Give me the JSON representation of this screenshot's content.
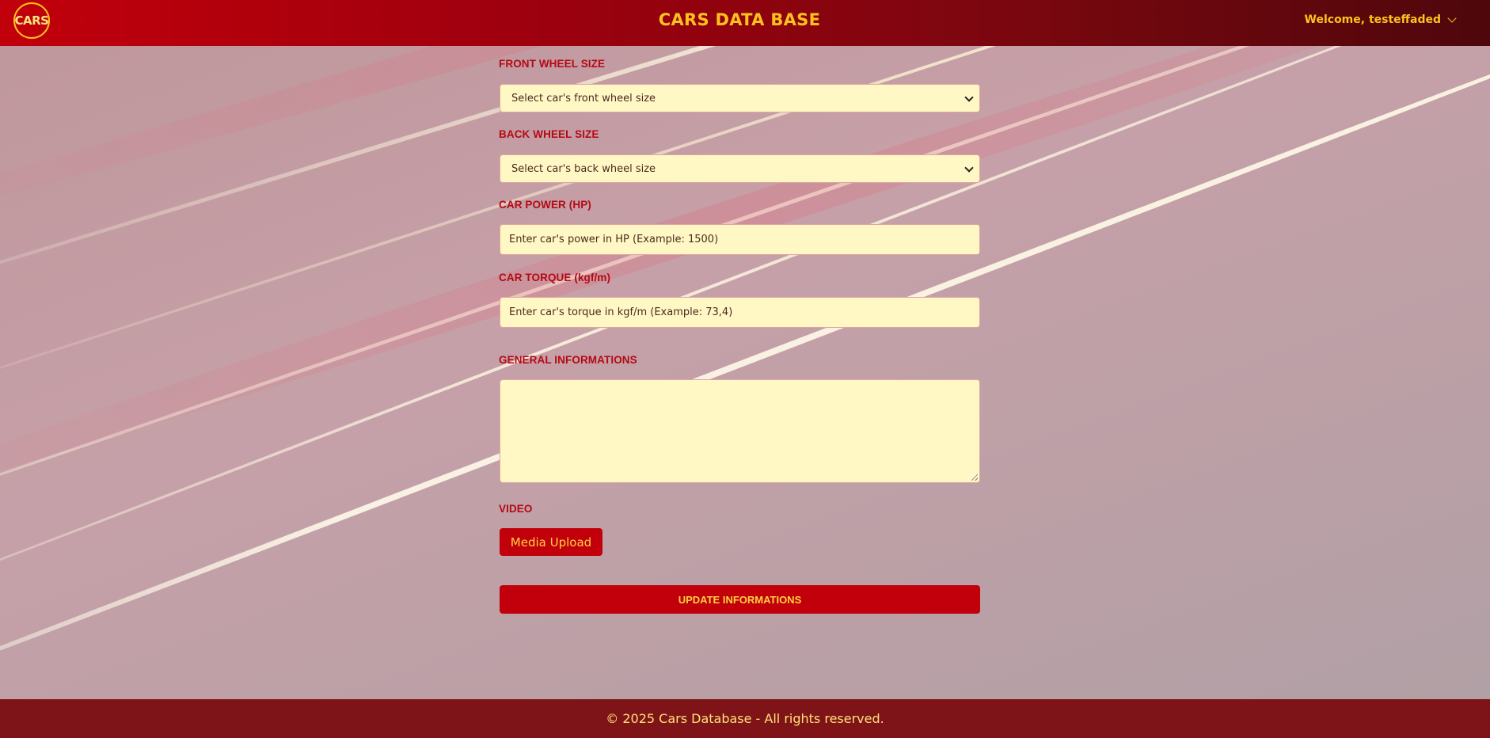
{
  "header": {
    "logo_text": "CARS",
    "title": "CARS DATA BASE",
    "welcome": "Welcome, testeffaded",
    "menu_icon": "chevron-down-icon"
  },
  "form": {
    "front_wheel": {
      "label": "FRONT WHEEL SIZE",
      "selected": "Select car's front wheel size"
    },
    "back_wheel": {
      "label": "BACK WHEEL SIZE",
      "selected": "Select car's back wheel size"
    },
    "power": {
      "label": "CAR POWER (HP)",
      "placeholder": "Enter car's power in HP (Example: 1500)"
    },
    "torque": {
      "label": "CAR TORQUE (kgf/m)",
      "placeholder": "Enter car's torque in kgf/m (Example: 73,4)"
    },
    "general": {
      "label": "GENERAL INFORMATIONS",
      "value": ""
    },
    "video": {
      "label": "VIDEO",
      "upload_label": "Media Upload"
    },
    "submit_label": "UPDATE INFORMATIONS"
  },
  "footer": {
    "text": "© 2025 Cars Database - All rights reserved."
  },
  "colors": {
    "header_start": "#c1000b",
    "header_end": "#4e070b",
    "accent_yellow": "#ffc21d",
    "label_red": "#b50914",
    "field_bg": "#fff8c4",
    "button_red": "#c1000b",
    "footer_bg": "#7f1418"
  }
}
